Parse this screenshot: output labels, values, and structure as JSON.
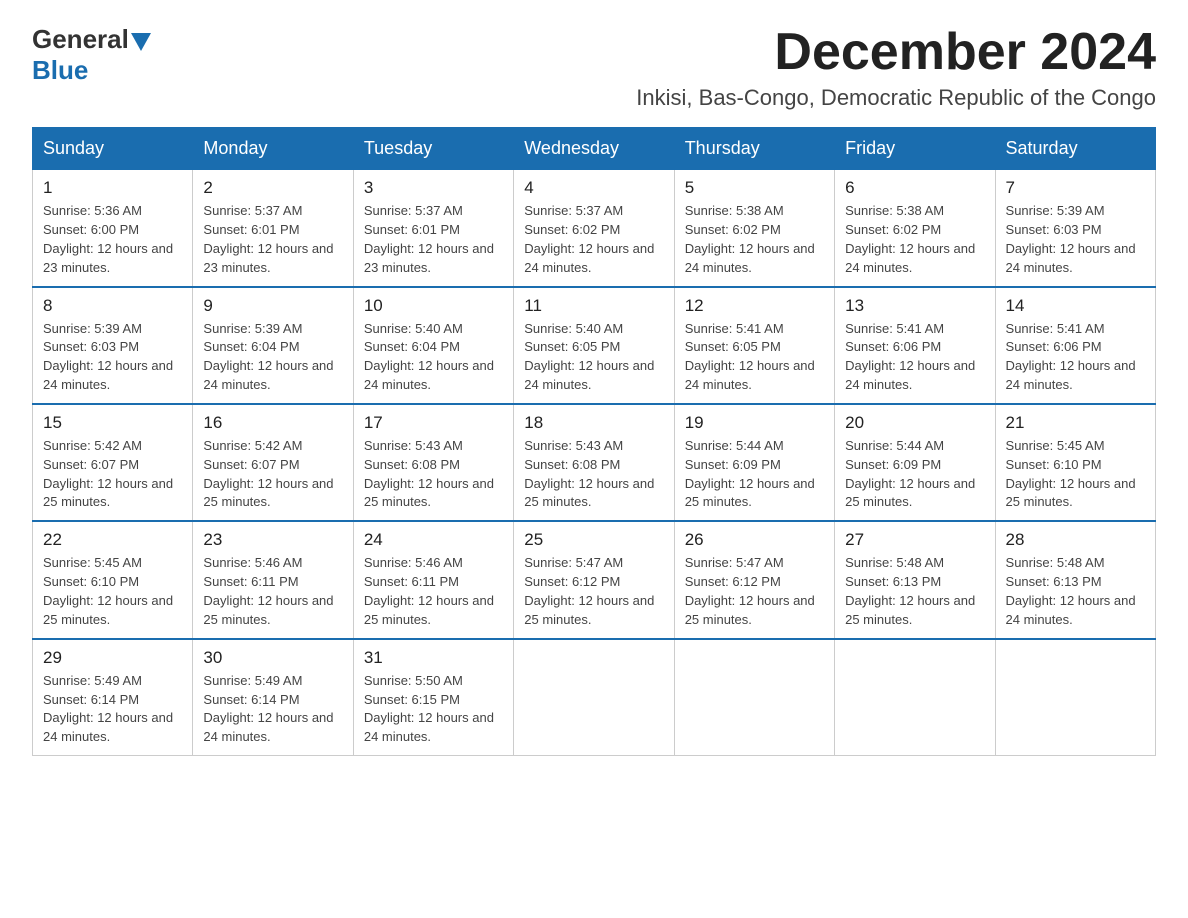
{
  "logo": {
    "general": "General",
    "blue": "Blue"
  },
  "header": {
    "title": "December 2024",
    "subtitle": "Inkisi, Bas-Congo, Democratic Republic of the Congo"
  },
  "weekdays": [
    "Sunday",
    "Monday",
    "Tuesday",
    "Wednesday",
    "Thursday",
    "Friday",
    "Saturday"
  ],
  "weeks": [
    [
      {
        "day": "1",
        "sunrise": "5:36 AM",
        "sunset": "6:00 PM",
        "daylight": "12 hours and 23 minutes."
      },
      {
        "day": "2",
        "sunrise": "5:37 AM",
        "sunset": "6:01 PM",
        "daylight": "12 hours and 23 minutes."
      },
      {
        "day": "3",
        "sunrise": "5:37 AM",
        "sunset": "6:01 PM",
        "daylight": "12 hours and 23 minutes."
      },
      {
        "day": "4",
        "sunrise": "5:37 AM",
        "sunset": "6:02 PM",
        "daylight": "12 hours and 24 minutes."
      },
      {
        "day": "5",
        "sunrise": "5:38 AM",
        "sunset": "6:02 PM",
        "daylight": "12 hours and 24 minutes."
      },
      {
        "day": "6",
        "sunrise": "5:38 AM",
        "sunset": "6:02 PM",
        "daylight": "12 hours and 24 minutes."
      },
      {
        "day": "7",
        "sunrise": "5:39 AM",
        "sunset": "6:03 PM",
        "daylight": "12 hours and 24 minutes."
      }
    ],
    [
      {
        "day": "8",
        "sunrise": "5:39 AM",
        "sunset": "6:03 PM",
        "daylight": "12 hours and 24 minutes."
      },
      {
        "day": "9",
        "sunrise": "5:39 AM",
        "sunset": "6:04 PM",
        "daylight": "12 hours and 24 minutes."
      },
      {
        "day": "10",
        "sunrise": "5:40 AM",
        "sunset": "6:04 PM",
        "daylight": "12 hours and 24 minutes."
      },
      {
        "day": "11",
        "sunrise": "5:40 AM",
        "sunset": "6:05 PM",
        "daylight": "12 hours and 24 minutes."
      },
      {
        "day": "12",
        "sunrise": "5:41 AM",
        "sunset": "6:05 PM",
        "daylight": "12 hours and 24 minutes."
      },
      {
        "day": "13",
        "sunrise": "5:41 AM",
        "sunset": "6:06 PM",
        "daylight": "12 hours and 24 minutes."
      },
      {
        "day": "14",
        "sunrise": "5:41 AM",
        "sunset": "6:06 PM",
        "daylight": "12 hours and 24 minutes."
      }
    ],
    [
      {
        "day": "15",
        "sunrise": "5:42 AM",
        "sunset": "6:07 PM",
        "daylight": "12 hours and 25 minutes."
      },
      {
        "day": "16",
        "sunrise": "5:42 AM",
        "sunset": "6:07 PM",
        "daylight": "12 hours and 25 minutes."
      },
      {
        "day": "17",
        "sunrise": "5:43 AM",
        "sunset": "6:08 PM",
        "daylight": "12 hours and 25 minutes."
      },
      {
        "day": "18",
        "sunrise": "5:43 AM",
        "sunset": "6:08 PM",
        "daylight": "12 hours and 25 minutes."
      },
      {
        "day": "19",
        "sunrise": "5:44 AM",
        "sunset": "6:09 PM",
        "daylight": "12 hours and 25 minutes."
      },
      {
        "day": "20",
        "sunrise": "5:44 AM",
        "sunset": "6:09 PM",
        "daylight": "12 hours and 25 minutes."
      },
      {
        "day": "21",
        "sunrise": "5:45 AM",
        "sunset": "6:10 PM",
        "daylight": "12 hours and 25 minutes."
      }
    ],
    [
      {
        "day": "22",
        "sunrise": "5:45 AM",
        "sunset": "6:10 PM",
        "daylight": "12 hours and 25 minutes."
      },
      {
        "day": "23",
        "sunrise": "5:46 AM",
        "sunset": "6:11 PM",
        "daylight": "12 hours and 25 minutes."
      },
      {
        "day": "24",
        "sunrise": "5:46 AM",
        "sunset": "6:11 PM",
        "daylight": "12 hours and 25 minutes."
      },
      {
        "day": "25",
        "sunrise": "5:47 AM",
        "sunset": "6:12 PM",
        "daylight": "12 hours and 25 minutes."
      },
      {
        "day": "26",
        "sunrise": "5:47 AM",
        "sunset": "6:12 PM",
        "daylight": "12 hours and 25 minutes."
      },
      {
        "day": "27",
        "sunrise": "5:48 AM",
        "sunset": "6:13 PM",
        "daylight": "12 hours and 25 minutes."
      },
      {
        "day": "28",
        "sunrise": "5:48 AM",
        "sunset": "6:13 PM",
        "daylight": "12 hours and 24 minutes."
      }
    ],
    [
      {
        "day": "29",
        "sunrise": "5:49 AM",
        "sunset": "6:14 PM",
        "daylight": "12 hours and 24 minutes."
      },
      {
        "day": "30",
        "sunrise": "5:49 AM",
        "sunset": "6:14 PM",
        "daylight": "12 hours and 24 minutes."
      },
      {
        "day": "31",
        "sunrise": "5:50 AM",
        "sunset": "6:15 PM",
        "daylight": "12 hours and 24 minutes."
      },
      null,
      null,
      null,
      null
    ]
  ]
}
